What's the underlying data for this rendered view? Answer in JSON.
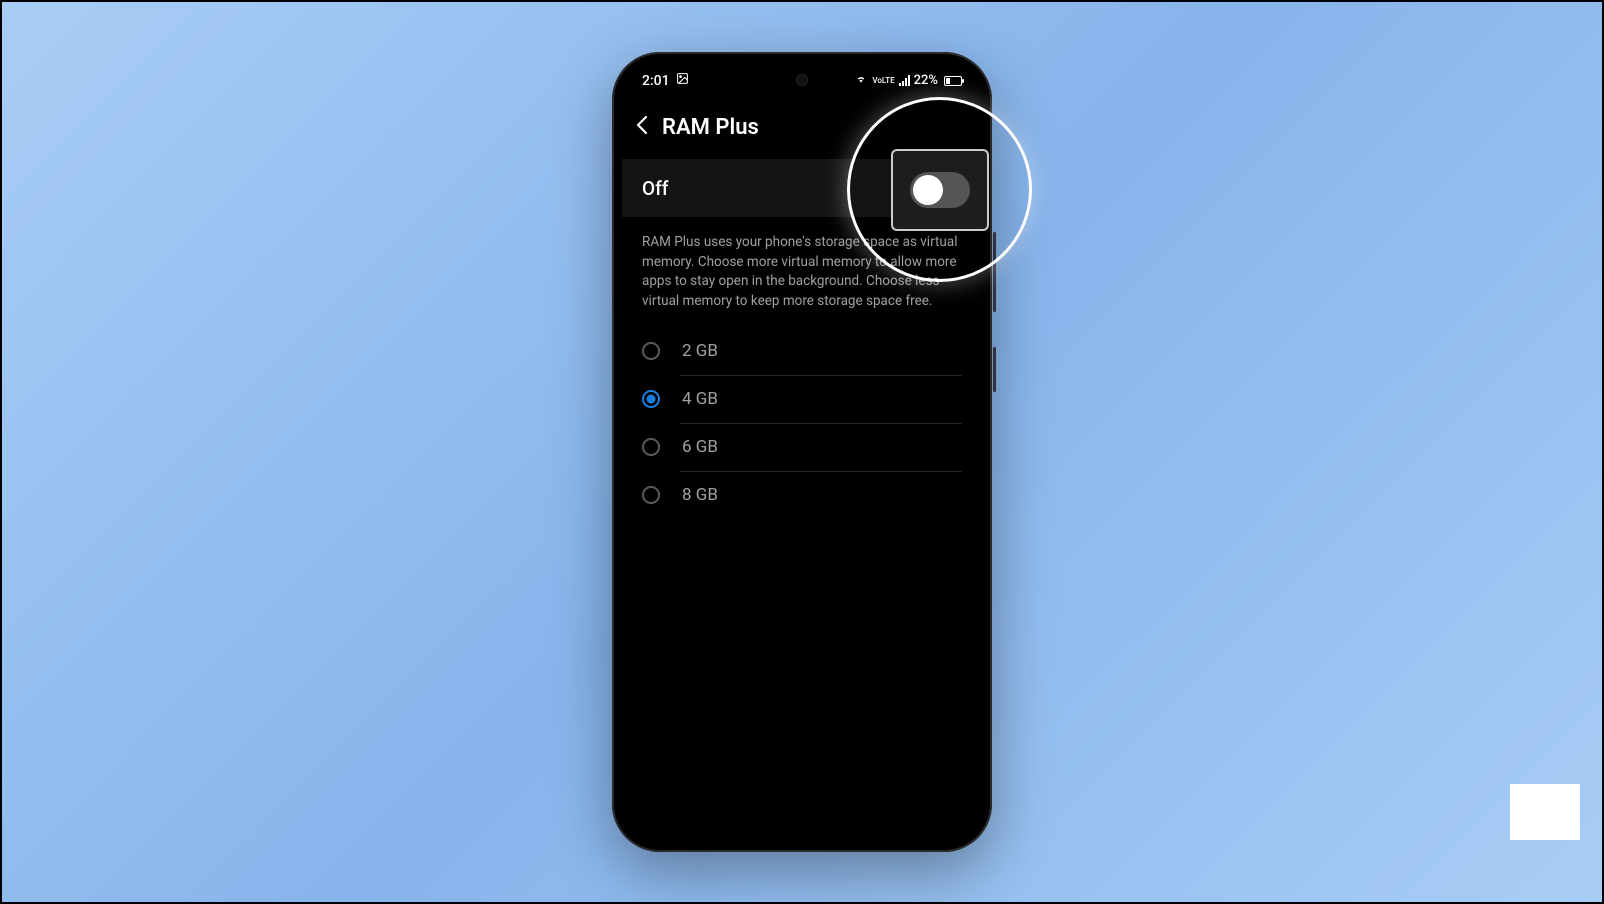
{
  "status": {
    "time": "2:01",
    "battery_pct": "22%",
    "network_label": "VoLTE"
  },
  "header": {
    "title": "RAM Plus"
  },
  "toggle": {
    "state_label": "Off",
    "enabled": false
  },
  "description": "RAM Plus uses your phone's storage space as virtual memory. Choose more virtual memory to allow more apps to stay open in the background. Choose less virtual memory to keep more storage space free.",
  "options": [
    {
      "label": "2 GB",
      "selected": false
    },
    {
      "label": "4 GB",
      "selected": true
    },
    {
      "label": "6 GB",
      "selected": false
    },
    {
      "label": "8 GB",
      "selected": false
    }
  ]
}
